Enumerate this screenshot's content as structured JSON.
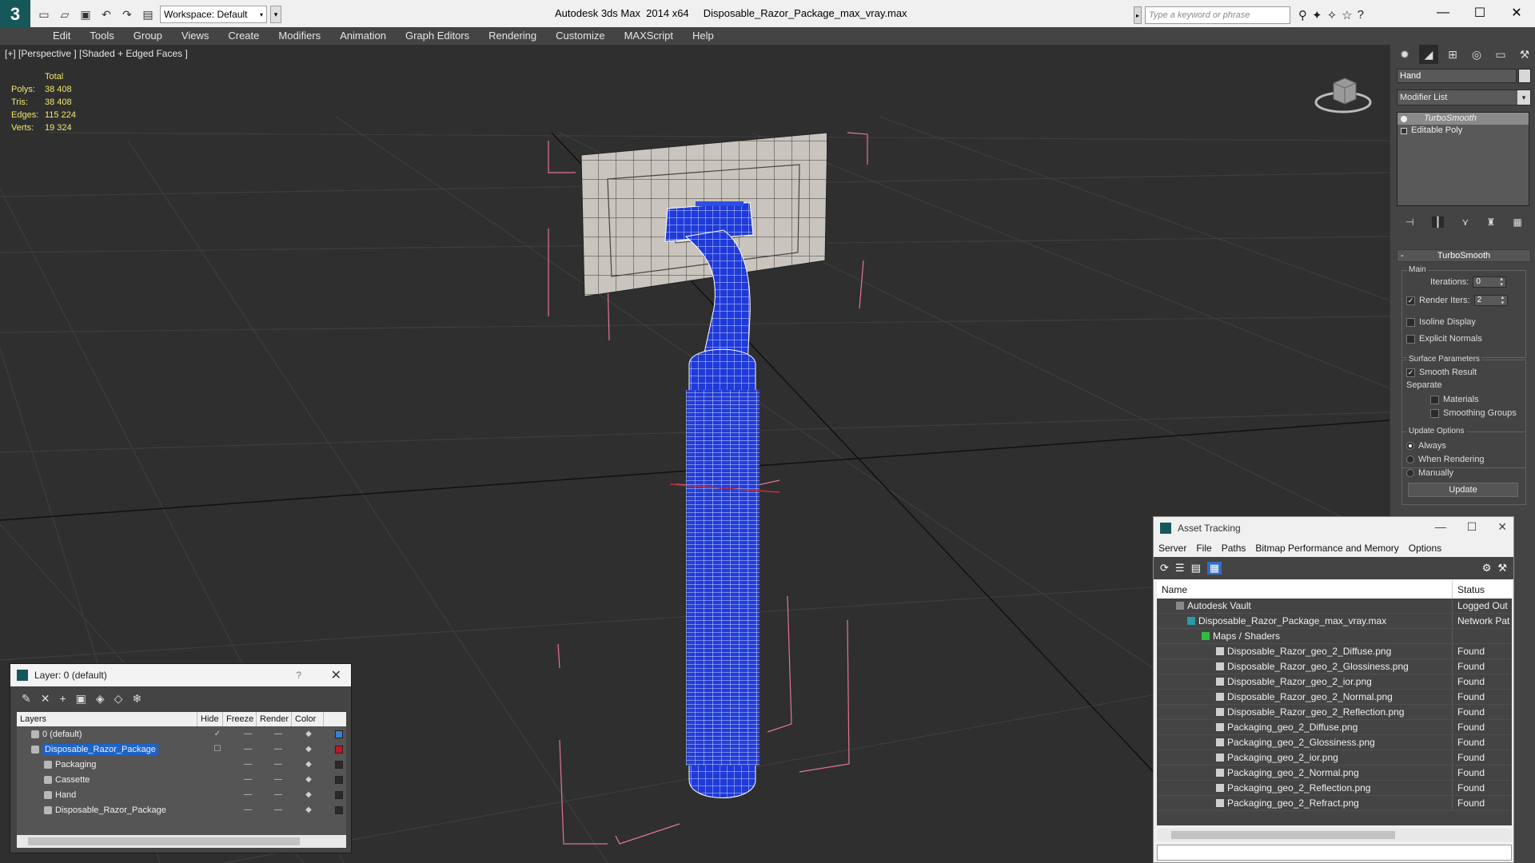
{
  "titlebar": {
    "workspace": "Workspace: Default",
    "title": "Autodesk 3ds Max  2014 x64     Disposable_Razor_Package_max_vray.max",
    "search_placeholder": "Type a keyword or phrase"
  },
  "menu": [
    "Edit",
    "Tools",
    "Group",
    "Views",
    "Create",
    "Modifiers",
    "Animation",
    "Graph Editors",
    "Rendering",
    "Customize",
    "MAXScript",
    "Help"
  ],
  "viewport": {
    "label": "[+] [Perspective ] [Shaded + Edged Faces ]",
    "stats": {
      "header": "Total",
      "polys_label": "Polys:",
      "polys": "38 408",
      "tris_label": "Tris:",
      "tris": "38 408",
      "edges_label": "Edges:",
      "edges": "115 224",
      "verts_label": "Verts:",
      "verts": "19 324"
    }
  },
  "command_panel": {
    "object_name": "Hand",
    "modifier_list": "Modifier List",
    "stack": [
      "TurboSmooth",
      "Editable Poly"
    ],
    "rollout": "TurboSmooth",
    "main_label": "Main",
    "iterations_label": "Iterations:",
    "iterations": "0",
    "render_iters_label": "Render Iters:",
    "render_iters": "2",
    "isoline": "Isoline Display",
    "explicit_normals": "Explicit Normals",
    "surface_params": "Surface Parameters",
    "smooth_result": "Smooth Result",
    "separate": "Separate",
    "materials": "Materials",
    "smoothing_groups": "Smoothing Groups",
    "update_options": "Update Options",
    "always": "Always",
    "when_rendering": "When Rendering",
    "manually": "Manually",
    "update": "Update"
  },
  "layer_dialog": {
    "title": "Layer: 0 (default)",
    "help": "?",
    "columns": [
      "Layers",
      "Hide",
      "Freeze",
      "Render",
      "Color"
    ],
    "rows": [
      {
        "name": "0 (default)",
        "color": "#3a7fd5"
      },
      {
        "name": "Disposable_Razor_Package",
        "color": "#c0142c"
      },
      {
        "name": "Packaging",
        "color": "#2a2a2a"
      },
      {
        "name": "Cassette",
        "color": "#2a2a2a"
      },
      {
        "name": "Hand",
        "color": "#2a2a2a"
      },
      {
        "name": "Disposable_Razor_Package",
        "color": "#2a2a2a"
      }
    ]
  },
  "asset_dialog": {
    "title": "Asset Tracking",
    "menu": [
      "Server",
      "File",
      "Paths",
      "Bitmap Performance and Memory",
      "Options"
    ],
    "col_name": "Name",
    "col_status": "Status",
    "rows": [
      {
        "name": "Autodesk Vault",
        "status": "Logged Out"
      },
      {
        "name": "Disposable_Razor_Package_max_vray.max",
        "status": "Network Pat"
      },
      {
        "name": "Maps / Shaders",
        "status": ""
      },
      {
        "name": "Disposable_Razor_geo_2_Diffuse.png",
        "status": "Found"
      },
      {
        "name": "Disposable_Razor_geo_2_Glossiness.png",
        "status": "Found"
      },
      {
        "name": "Disposable_Razor_geo_2_ior.png",
        "status": "Found"
      },
      {
        "name": "Disposable_Razor_geo_2_Normal.png",
        "status": "Found"
      },
      {
        "name": "Disposable_Razor_geo_2_Reflection.png",
        "status": "Found"
      },
      {
        "name": "Packaging_geo_2_Diffuse.png",
        "status": "Found"
      },
      {
        "name": "Packaging_geo_2_Glossiness.png",
        "status": "Found"
      },
      {
        "name": "Packaging_geo_2_ior.png",
        "status": "Found"
      },
      {
        "name": "Packaging_geo_2_Normal.png",
        "status": "Found"
      },
      {
        "name": "Packaging_geo_2_Reflection.png",
        "status": "Found"
      },
      {
        "name": "Packaging_geo_2_Refract.png",
        "status": "Found"
      }
    ]
  }
}
